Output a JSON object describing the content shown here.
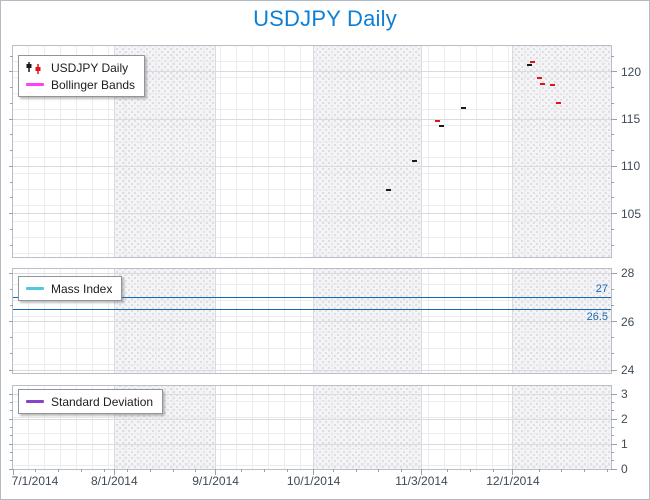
{
  "title": "USDJPY Daily",
  "colors": {
    "title": "#0e7fd6",
    "candle-black": "#1a1a1a",
    "candle-red": "#e01414",
    "bollinger": "#fb41fb",
    "mass-index": "#4ec9e1",
    "std-dev": "#8843c8",
    "constant-line": "#1767b3",
    "axis-text": "#3f4a56",
    "grid-minor": "#ececf0",
    "grid-major": "#d9dbdf",
    "band-bg": "#f4f4f6",
    "band-dot": "#c9cbd3",
    "panel-border": "#b9bfc7",
    "tick": "#9aa1aa",
    "window-border": "#b4bac1",
    "legend-border": "#8f959c",
    "legend-text": "#1d1d1d"
  },
  "legends": {
    "price": [
      "USDJPY Daily",
      "Bollinger Bands"
    ],
    "mass": [
      "Mass Index"
    ],
    "std": [
      "Standard Deviation"
    ]
  },
  "chart_data": {
    "type": "candlestick",
    "title": "USDJPY Daily",
    "x_axis": {
      "start": "2014-07-01",
      "end": "2014-12-31",
      "ticks": [
        {
          "label": "7/1/2014",
          "date": "2014-07-01"
        },
        {
          "label": "8/1/2014",
          "date": "2014-08-01"
        },
        {
          "label": "9/1/2014",
          "date": "2014-09-01"
        },
        {
          "label": "10/1/2014",
          "date": "2014-10-01"
        },
        {
          "label": "11/3/2014",
          "date": "2014-11-03"
        },
        {
          "label": "12/1/2014",
          "date": "2014-12-01"
        }
      ],
      "minor_tick_interval_days": 7,
      "shaded_bands": [
        [
          "2014-08-01",
          "2014-09-01"
        ],
        [
          "2014-10-01",
          "2014-11-03"
        ],
        [
          "2014-12-01",
          "2014-12-31"
        ]
      ]
    },
    "panels": [
      {
        "id": "price",
        "legend": [
          "USDJPY Daily",
          "Bollinger Bands"
        ],
        "ylim": [
          100.4,
          122.75
        ],
        "yticks": [
          105,
          110,
          115,
          120
        ],
        "series": [
          {
            "name": "USDJPY Daily",
            "type": "candlestick",
            "points": [
              {
                "date": "2014-10-24",
                "close": 107.5,
                "color": "black"
              },
              {
                "date": "2014-11-01",
                "close": 110.6,
                "color": "black"
              },
              {
                "date": "2014-11-08",
                "close": 114.8,
                "color": "red"
              },
              {
                "date": "2014-11-09",
                "close": 114.3,
                "color": "black"
              },
              {
                "date": "2014-11-16",
                "close": 116.2,
                "color": "black"
              },
              {
                "date": "2014-12-06",
                "close": 120.7,
                "color": "black"
              },
              {
                "date": "2014-12-07",
                "close": 121.1,
                "color": "red"
              },
              {
                "date": "2014-12-09",
                "close": 119.4,
                "color": "red"
              },
              {
                "date": "2014-12-10",
                "close": 118.7,
                "color": "red"
              },
              {
                "date": "2014-12-13",
                "close": 118.6,
                "color": "red"
              },
              {
                "date": "2014-12-15",
                "close": 116.7,
                "color": "red"
              }
            ]
          },
          {
            "name": "Bollinger Bands",
            "type": "line",
            "points": []
          }
        ]
      },
      {
        "id": "mass",
        "legend": [
          "Mass Index"
        ],
        "ylim": [
          23.88,
          28.17
        ],
        "yticks": [
          24,
          26,
          28
        ],
        "constant_lines": [
          {
            "value": 27,
            "label": "27",
            "label_position": "above"
          },
          {
            "value": 26.5,
            "label": "26.5",
            "label_position": "below"
          }
        ],
        "series": [
          {
            "name": "Mass Index",
            "type": "line",
            "points": []
          }
        ]
      },
      {
        "id": "std",
        "legend": [
          "Standard Deviation"
        ],
        "ylim": [
          0,
          3.32
        ],
        "yticks": [
          0,
          1,
          2,
          3
        ],
        "series": [
          {
            "name": "Standard Deviation",
            "type": "line",
            "points": []
          }
        ]
      }
    ]
  }
}
